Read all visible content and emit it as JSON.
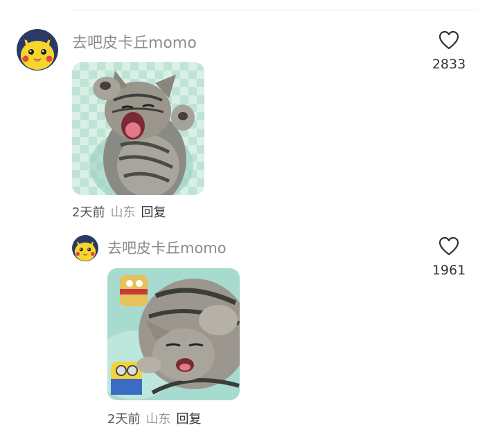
{
  "comments": [
    {
      "username": "去吧皮卡丘momo",
      "time": "2天前",
      "location": "山东",
      "reply_label": "回复",
      "like_count": "2833",
      "avatar_icon": "pikachu-avatar-icon",
      "image_icon": "kitten-yawning-photo"
    },
    {
      "username": "去吧皮卡丘momo",
      "time": "2天前",
      "location": "山东",
      "reply_label": "回复",
      "like_count": "1961",
      "avatar_icon": "pikachu-avatar-icon",
      "image_icon": "kitten-sleeping-photo"
    }
  ],
  "colors": {
    "username": "#8c8c8c",
    "location": "#9a9a9a",
    "count": "#333333",
    "pikachu_yellow": "#f6d52c"
  }
}
